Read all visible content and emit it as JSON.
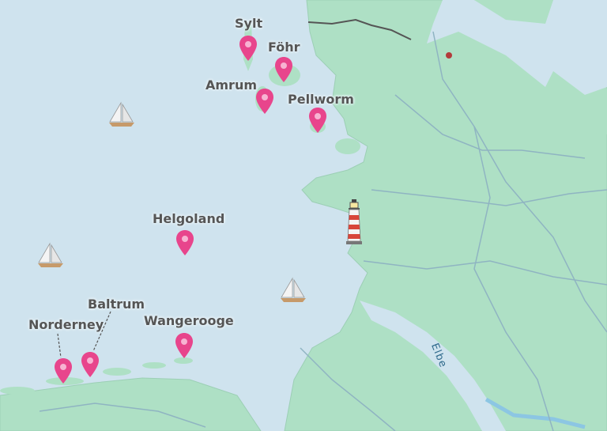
{
  "map": {
    "colors": {
      "sea": "#cfe3ee",
      "land": "#aee0c5",
      "road": "#8fb4c2",
      "pin": "#e8458c",
      "river": "#8cc6e3"
    },
    "markers": [
      {
        "id": "sylt",
        "label": "Sylt"
      },
      {
        "id": "fohr",
        "label": "Föhr"
      },
      {
        "id": "amrum",
        "label": "Amrum"
      },
      {
        "id": "pellworm",
        "label": "Pellworm"
      },
      {
        "id": "helgoland",
        "label": "Helgoland"
      },
      {
        "id": "wangerooge",
        "label": "Wangerooge"
      },
      {
        "id": "baltrum",
        "label": "Baltrum"
      },
      {
        "id": "norderney",
        "label": "Norderney"
      }
    ],
    "river_label": "Elbe",
    "icons": [
      "sailboat-icon",
      "lighthouse-icon",
      "map-pin-icon"
    ]
  }
}
